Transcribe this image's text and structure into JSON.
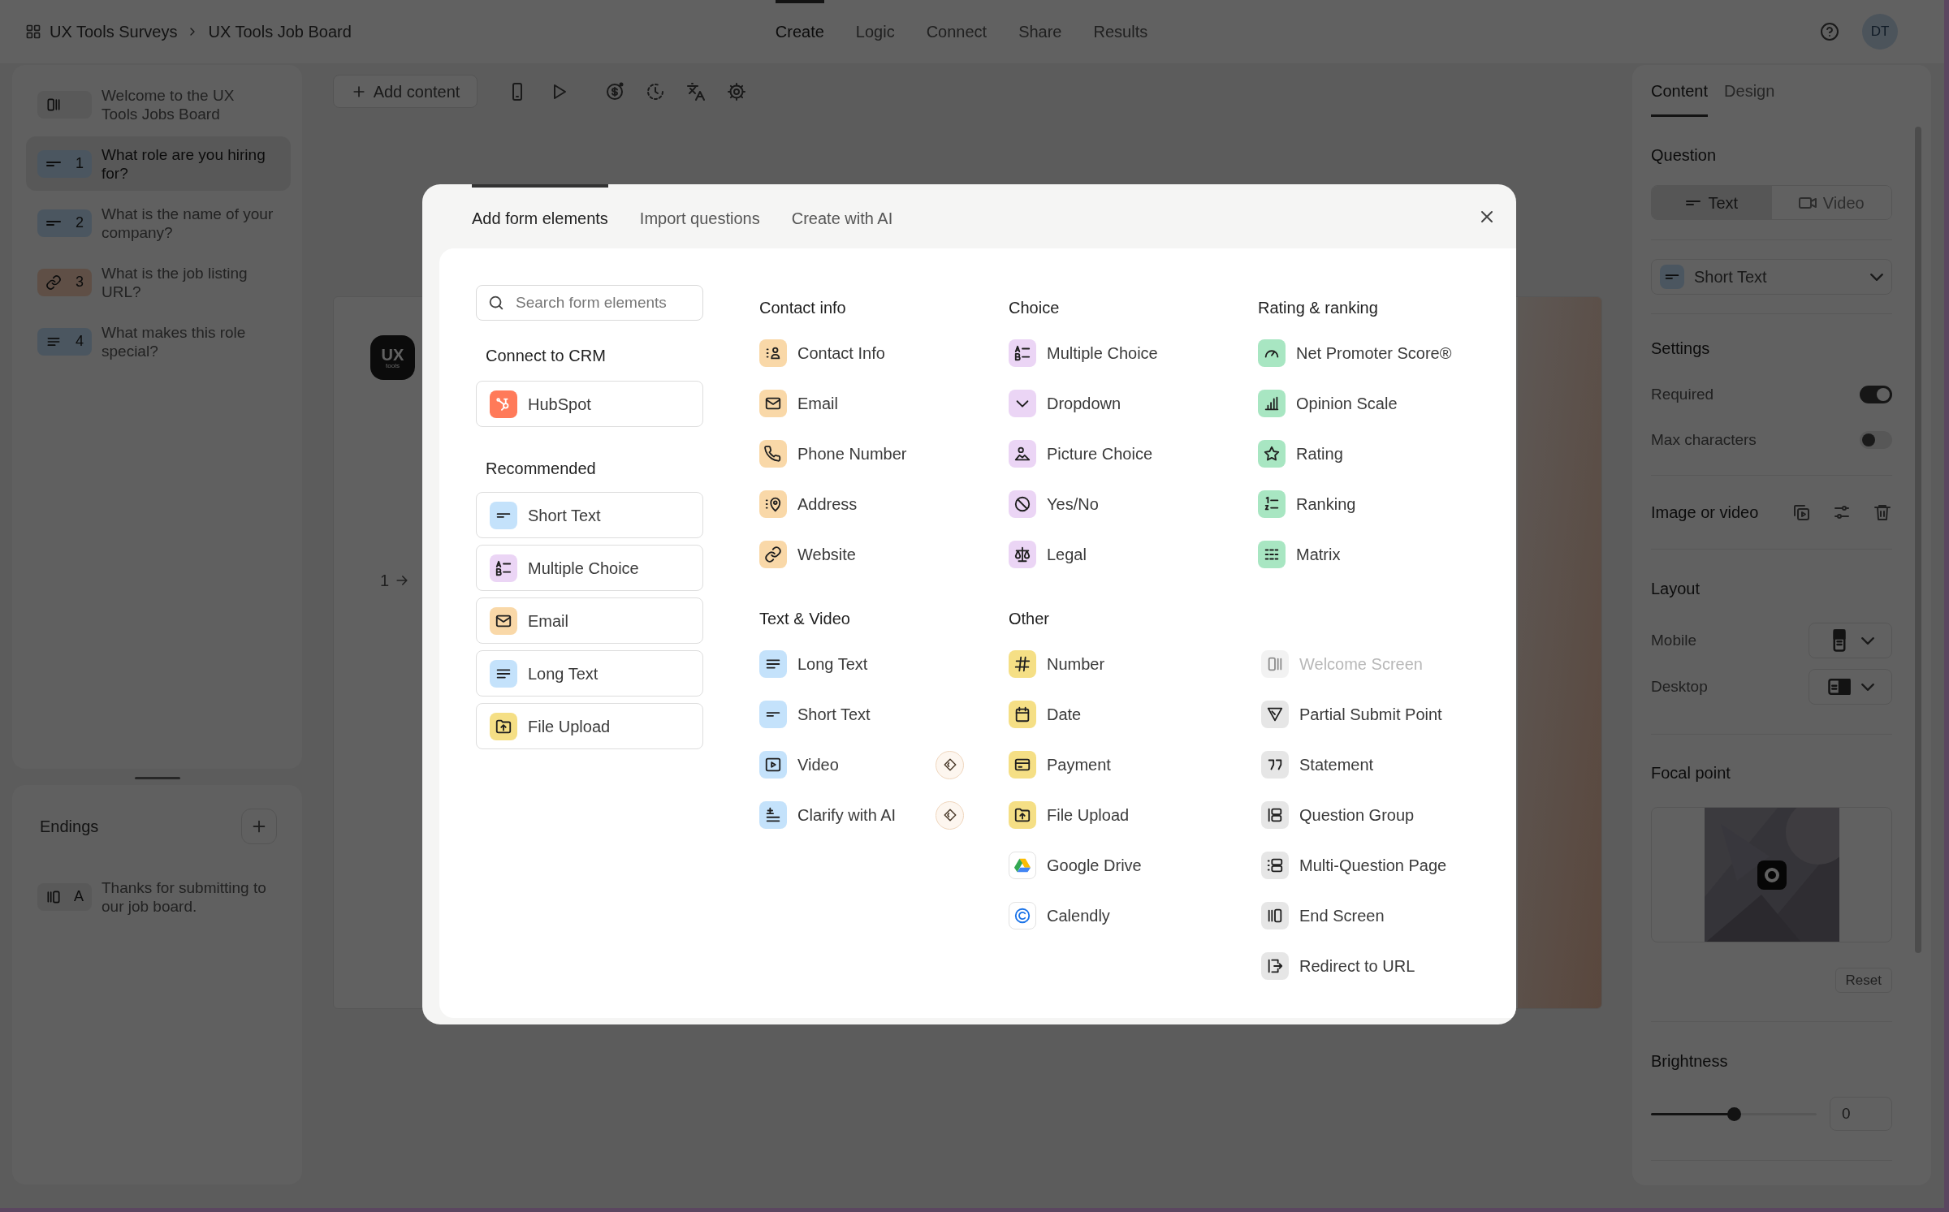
{
  "breadcrumb": [
    {
      "label": "UX Tools Surveys"
    },
    {
      "label": "UX Tools Job Board"
    }
  ],
  "nav_tabs": [
    {
      "label": "Create",
      "selected": true
    },
    {
      "label": "Logic",
      "selected": false
    },
    {
      "label": "Connect",
      "selected": false
    },
    {
      "label": "Share",
      "selected": false
    },
    {
      "label": "Results",
      "selected": false
    }
  ],
  "avatar": "DT",
  "toolbar": {
    "add_content": "Add content"
  },
  "questions": [
    {
      "kind": "welcome",
      "text": "Welcome to the UX Tools Jobs Board",
      "selected": false
    },
    {
      "kind": "short_text",
      "number": "1",
      "text": "What role are you hiring for?",
      "selected": true
    },
    {
      "kind": "short_text",
      "number": "2",
      "text": "What is the name of your company?",
      "selected": false
    },
    {
      "kind": "website",
      "number": "3",
      "text": "What is the job listing URL?",
      "selected": false
    },
    {
      "kind": "long_text",
      "number": "4",
      "text": "What makes this role special?",
      "selected": false
    }
  ],
  "endings": {
    "title": "Endings",
    "items": [
      {
        "kind": "end_screen",
        "number": "A",
        "text": "Thanks for submitting to our job board."
      }
    ]
  },
  "canvas": {
    "logo": {
      "title": "UX",
      "subtitle": "tools"
    },
    "step": "1"
  },
  "modal": {
    "tabs": [
      {
        "label": "Add form elements",
        "selected": true
      },
      {
        "label": "Import questions",
        "selected": false
      },
      {
        "label": "Create with AI",
        "selected": false
      }
    ],
    "search": {
      "placeholder": "Search form elements"
    },
    "crm": {
      "heading": "Connect to CRM",
      "items": [
        {
          "kind": "hubspot",
          "label": "HubSpot"
        }
      ]
    },
    "recommended": {
      "heading": "Recommended",
      "items": [
        {
          "kind": "short_text",
          "label": "Short Text"
        },
        {
          "kind": "multiple_choice",
          "label": "Multiple Choice"
        },
        {
          "kind": "email",
          "label": "Email"
        },
        {
          "kind": "long_text",
          "label": "Long Text"
        },
        {
          "kind": "file_upload",
          "label": "File Upload"
        }
      ]
    },
    "groups": [
      {
        "heading": "Contact info",
        "items": [
          {
            "kind": "contact",
            "label": "Contact Info"
          },
          {
            "kind": "email",
            "label": "Email"
          },
          {
            "kind": "phone",
            "label": "Phone Number"
          },
          {
            "kind": "address",
            "label": "Address"
          },
          {
            "kind": "website",
            "label": "Website"
          }
        ]
      },
      {
        "heading": "Choice",
        "items": [
          {
            "kind": "multiple_choice",
            "label": "Multiple Choice"
          },
          {
            "kind": "dropdown",
            "label": "Dropdown"
          },
          {
            "kind": "picture_choice",
            "label": "Picture Choice"
          },
          {
            "kind": "yes_no",
            "label": "Yes/No"
          },
          {
            "kind": "legal",
            "label": "Legal"
          }
        ]
      },
      {
        "heading": "Rating & ranking",
        "items": [
          {
            "kind": "nps",
            "label": "Net Promoter Score®"
          },
          {
            "kind": "opinion_scale",
            "label": "Opinion Scale"
          },
          {
            "kind": "rating",
            "label": "Rating"
          },
          {
            "kind": "ranking",
            "label": "Ranking"
          },
          {
            "kind": "matrix",
            "label": "Matrix"
          }
        ]
      },
      {
        "heading": "Text & Video",
        "items": [
          {
            "kind": "long_text",
            "label": "Long Text",
            "premium": false
          },
          {
            "kind": "short_text",
            "label": "Short Text",
            "premium": false
          },
          {
            "kind": "video",
            "label": "Video",
            "premium": true
          },
          {
            "kind": "clarify",
            "label": "Clarify with AI",
            "premium": true
          }
        ]
      },
      {
        "heading": "Other",
        "columns": [
          [
            {
              "kind": "number",
              "label": "Number",
              "disabled": false
            },
            {
              "kind": "date",
              "label": "Date",
              "disabled": false
            },
            {
              "kind": "payment",
              "label": "Payment",
              "disabled": false
            },
            {
              "kind": "file_upload",
              "label": "File Upload",
              "disabled": false
            },
            {
              "kind": "google_drive",
              "label": "Google Drive",
              "disabled": false
            },
            {
              "kind": "calendly",
              "label": "Calendly",
              "disabled": false
            }
          ],
          [
            {
              "kind": "welcome",
              "label": "Welcome Screen",
              "disabled": true
            },
            {
              "kind": "partial_submit",
              "label": "Partial Submit Point",
              "disabled": false
            },
            {
              "kind": "statement",
              "label": "Statement",
              "disabled": false
            },
            {
              "kind": "question_group",
              "label": "Question Group",
              "disabled": false
            },
            {
              "kind": "multi_question",
              "label": "Multi-Question Page",
              "disabled": false
            },
            {
              "kind": "end_screen",
              "label": "End Screen",
              "disabled": false
            },
            {
              "kind": "redirect",
              "label": "Redirect to URL",
              "disabled": false
            }
          ]
        ]
      }
    ]
  },
  "settings_panel": {
    "tabs": [
      {
        "label": "Content",
        "selected": true
      },
      {
        "label": "Design",
        "selected": false
      }
    ],
    "question": {
      "title": "Question",
      "modes": [
        {
          "kind": "text",
          "label": "Text",
          "selected": true
        },
        {
          "kind": "video",
          "label": "Video",
          "selected": false
        }
      ],
      "type": {
        "kind": "short_text",
        "label": "Short Text"
      }
    },
    "settings": {
      "title": "Settings",
      "toggles": [
        {
          "label": "Required",
          "on": true
        },
        {
          "label": "Max characters",
          "on": false
        }
      ]
    },
    "media": {
      "title": "Image or video"
    },
    "layout": {
      "title": "Layout",
      "rows": [
        {
          "kind": "mobile",
          "label": "Mobile"
        },
        {
          "kind": "desktop",
          "label": "Desktop"
        }
      ]
    },
    "focal_point": {
      "title": "Focal point",
      "reset": "Reset"
    },
    "brightness": {
      "title": "Brightness",
      "level": 0.5,
      "value": "0"
    }
  }
}
